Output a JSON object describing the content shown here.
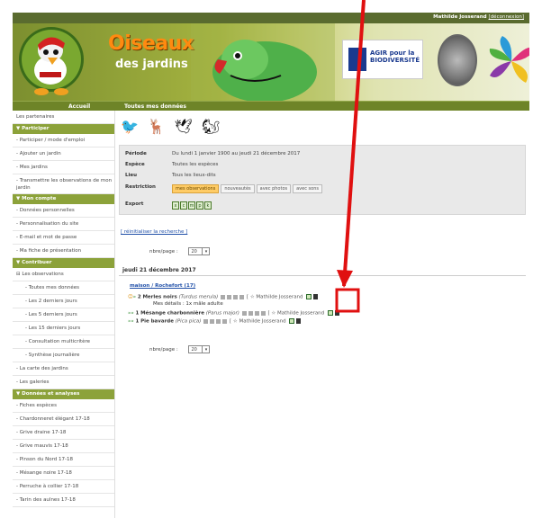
{
  "topbar": {
    "user": "Mathilde Josserand",
    "logout": "[déconnexion]"
  },
  "banner": {
    "title_line1": "Oiseaux",
    "title_line2": "des jardins",
    "agir_text": "AGIR pour la BIODIVERSITÉ"
  },
  "nav": {
    "home": "Accueil",
    "section": "Toutes mes données"
  },
  "sidebar": {
    "partners": "Les partenaires",
    "participate_head": "Participer",
    "participate": [
      "- Participer / mode d'emploi",
      "- Ajouter un jardin",
      "- Mes jardins",
      "- Transmettre les observations de mon jardin"
    ],
    "account_head": "Mon compte",
    "account": [
      "- Données personnelles",
      "- Personnalisation du site",
      "- E-mail et mot de passe",
      "- Ma fiche de présentation"
    ],
    "contribute_head": "Contribuer",
    "obs_root": "Les observations",
    "obs_children": [
      "- Toutes mes données",
      "- Les 2 derniers jours",
      "- Les 5 derniers jours",
      "- Les 15 derniers jours",
      "- Consultation multicritère",
      "- Synthèse journalière"
    ],
    "other": [
      "- La carte des jardins",
      "- Les galeries"
    ],
    "data_head": "Données et analyses",
    "data": [
      "- Fiches espèces",
      "- Chardonneret élégant 17-18",
      "- Grive draine 17-18",
      "- Grive mauvis 17-18",
      "- Pinson du Nord 17-18",
      "- Mésange noire 17-18",
      "- Perruche à collier 17-18",
      "- Tarin des aulnes 17-18"
    ]
  },
  "filters": {
    "period_label": "Période",
    "period_value": "Du lundi 1 janvier 1900 au jeudi 21 décembre 2017",
    "species_label": "Espèce",
    "species_value": "Toutes les espèces",
    "place_label": "Lieu",
    "place_value": "Tous les lieux-dits",
    "restriction_label": "Restriction",
    "restrictions": [
      "mes observations",
      "nouveautés",
      "avec photos",
      "avec sons"
    ],
    "export_label": "Export"
  },
  "reset_link": "[ réinitialiser la recherche ]",
  "perpage_label": "nbre/page :",
  "perpage_value": "20",
  "date_heading": "jeudi 21 décembre 2017",
  "place_link": "maison / Rochefort (17)",
  "observations": [
    {
      "count": "2",
      "name": "Merles noirs",
      "latin": "(Turdus merula)",
      "user": "Mathilde Josserand",
      "details": "Mes détails : 1x mâle adulte"
    },
    {
      "count": "1",
      "name": "Mésange charbonnière",
      "latin": "(Parus major)",
      "user": "Mathilde Josserand"
    },
    {
      "count": "1",
      "name": "Pie bavarde",
      "latin": "(Pica pica)",
      "user": "Mathilde Josserand"
    }
  ],
  "colors": {
    "accent_green": "#8ca23a",
    "nav_green": "#6e8428",
    "annotation_red": "#e01010"
  }
}
